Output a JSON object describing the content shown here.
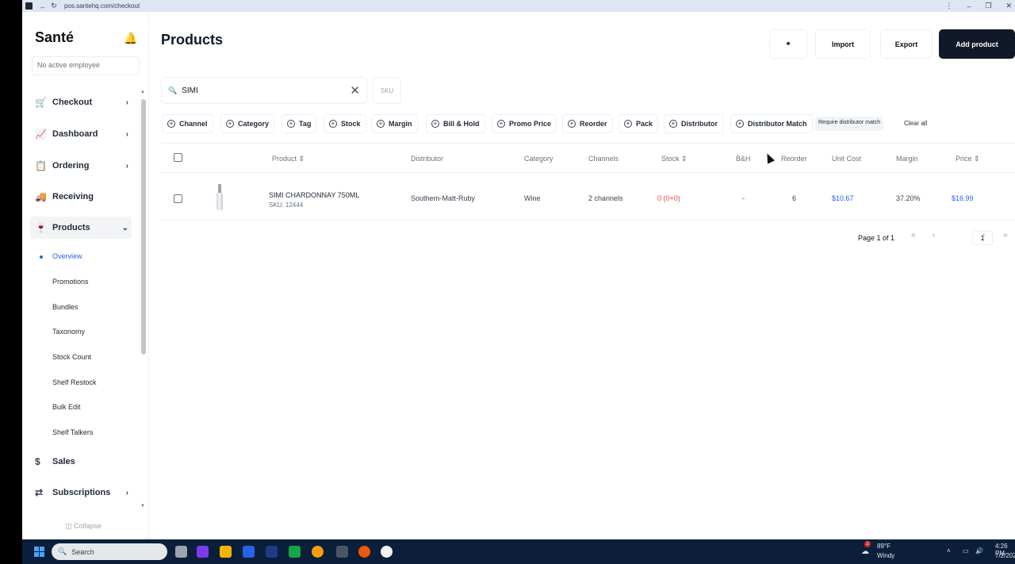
{
  "browser": {
    "url": "pos.santehq.com/checkout"
  },
  "sidebar": {
    "brand": "Santé",
    "employee": "No active employee",
    "items": [
      {
        "label": "Checkout"
      },
      {
        "label": "Dashboard"
      },
      {
        "label": "Ordering"
      },
      {
        "label": "Receiving"
      },
      {
        "label": "Products"
      }
    ],
    "sub_items": [
      {
        "label": "Overview"
      },
      {
        "label": "Promotions"
      },
      {
        "label": "Bundles"
      },
      {
        "label": "Taxonomy"
      },
      {
        "label": "Stock Count"
      },
      {
        "label": "Shelf Restock"
      },
      {
        "label": "Bulk Edit"
      },
      {
        "label": "Shelf Talkers"
      }
    ],
    "bottom_items": [
      {
        "label": "Sales"
      },
      {
        "label": "Subscriptions"
      }
    ],
    "collapse_label": "Collapse"
  },
  "page": {
    "title": "Products",
    "import_label": "Import",
    "export_label": "Export",
    "add_label": "Add product",
    "search_value": "SIMI",
    "sku_label": "SKU",
    "filters": [
      "Channel",
      "Category",
      "Tag",
      "Stock",
      "Margin",
      "Bill & Hold",
      "Promo Price",
      "Reorder",
      "Pack",
      "Distributor",
      "Distributor Match"
    ],
    "require_label": "Require distributor match",
    "clear_all": "Clear all"
  },
  "table": {
    "headers": [
      "Product",
      "Distributor",
      "Category",
      "Channels",
      "Stock",
      "B&H",
      "Reorder",
      "Unit Cost",
      "Margin",
      "Price"
    ],
    "rows": [
      {
        "name": "SIMI CHARDONNAY 750ML",
        "sku": "SKU: 12444",
        "distributor": "Southern-Matt-Ruby",
        "category": "Wine",
        "channels": "2 channels",
        "stock": "0 (0+0)",
        "bh": "-",
        "reorder": "6",
        "unit_cost": "$10.67",
        "margin": "37.20%",
        "price": "$16.99"
      }
    ]
  },
  "pagination": {
    "label": "Page 1 of 1",
    "current": "1"
  },
  "taskbar": {
    "search": "Search",
    "weather": "89°F",
    "weather_desc": "Windy",
    "time": "4:26 PM",
    "date": "7/2/202",
    "badge": "2"
  },
  "colors": {
    "accent": "#2563eb",
    "primary_button": "#111827",
    "stock_red": "#ef4444",
    "taskbar": "#0b1f3a"
  }
}
